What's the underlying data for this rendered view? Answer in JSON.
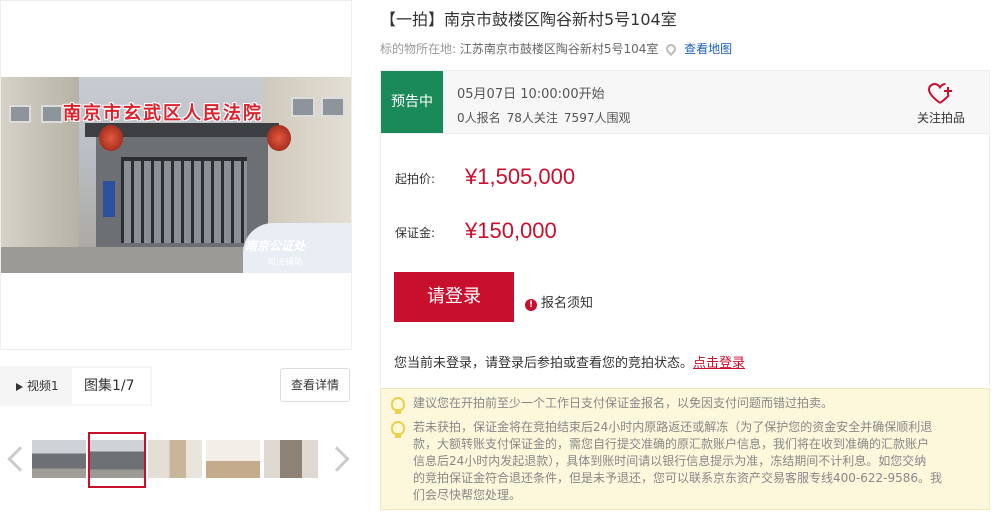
{
  "gallery": {
    "main_photo": {
      "overlay_title": "南京市玄武区人民法院",
      "overlay_watermark": "南京公证处",
      "overlay_watermark_sub": "司法辅助"
    },
    "tabs": [
      {
        "label": "视频1"
      },
      {
        "label": "图集1/7"
      }
    ],
    "view_details_label": "查看详情",
    "thumbnails_count": 5,
    "selected_thumbnail": 2
  },
  "item": {
    "title": "【一拍】南京市鼓楼区陶谷新村5号104室",
    "location_label": "标的物所在地:",
    "location_value": "江苏南京市鼓楼区陶谷新村5号104室",
    "map_link": "查看地图"
  },
  "status": {
    "tag": "预告中",
    "start_time": "05月07日 10:00:00开始",
    "signups": "0人报名",
    "followers": "78人关注",
    "viewers": "7597人围观",
    "follow_label": "关注拍品"
  },
  "price": {
    "start_label": "起拍价:",
    "start_value": "¥1,505,000",
    "deposit_label": "保证金:",
    "deposit_value": "¥150,000",
    "login_button": "请登录",
    "notice_label": "报名须知",
    "login_hint_text": "您当前未登录，请登录后参拍或查看您的竞拍状态。",
    "login_hint_link": "点击登录"
  },
  "tips": {
    "tip1": "建议您在开拍前至少一个工作日支付保证金报名，以免因支付问题而错过拍卖。",
    "tip2_line1": "若未获拍，保证金将在竞拍结束后24小时内原路返还或解冻（为了保护您的资金安全并确保顺利退",
    "tip2_line2": "款，大额转账支付保证金的，需您自行提交准确的原汇款账户信息，我们将在收到准确的汇款账户",
    "tip2_line3": "信息后24小时内发起退款），具体到账时间请以银行信息提示为准，冻结期间不计利息。如您交纳",
    "tip2_line4": "的竞拍保证金符合退还条件，但是未予退还，您可以联系京东资产交易客服专线400-622-9586。我",
    "tip2_line5": "们会尽快帮您处理。"
  },
  "colors": {
    "accent_red": "#c8102e",
    "status_green": "#1b8a5a",
    "link_blue": "#1a5fb4",
    "tip_bg": "#fdf7dc"
  }
}
